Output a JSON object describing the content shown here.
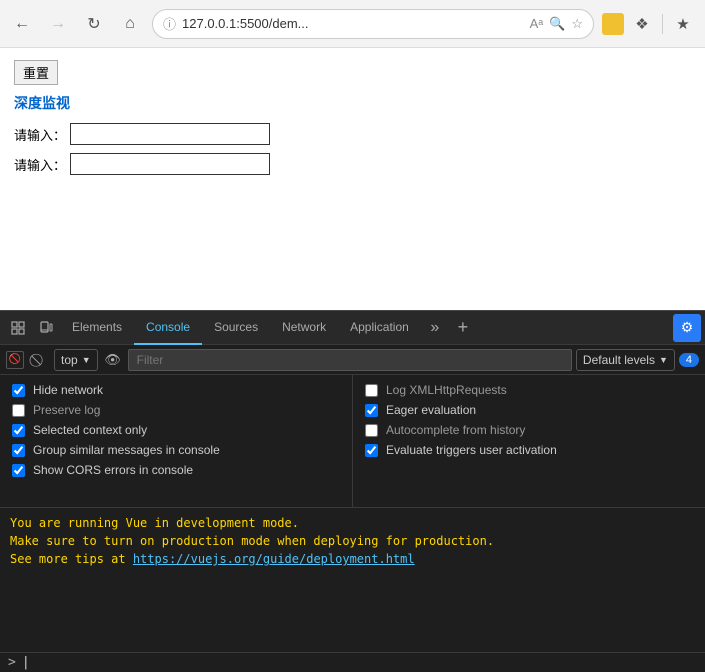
{
  "browser": {
    "address": "127.0.0.1:5500/dem...",
    "nav": {
      "back": "←",
      "forward": "→",
      "refresh": "↻",
      "home": "⌂"
    }
  },
  "page": {
    "reset_label": "重置",
    "title": "深度监视",
    "label1": "请输入：",
    "label2": "请输入：",
    "input1_value": "",
    "input2_value": ""
  },
  "devtools": {
    "tabs": [
      "Elements",
      "Console",
      "Sources",
      "Network",
      "Application"
    ],
    "active_tab": "Console",
    "toolbar": {
      "context": "top",
      "filter_placeholder": "Filter",
      "levels_label": "Default levels",
      "badge_count": "4"
    },
    "settings": {
      "left": [
        {
          "label": "Hide network",
          "checked": true
        },
        {
          "label": "Preserve log",
          "checked": false
        },
        {
          "label": "Selected context only",
          "checked": true
        },
        {
          "label": "Group similar messages in console",
          "checked": true
        },
        {
          "label": "Show CORS errors in console",
          "checked": true
        }
      ],
      "right": [
        {
          "label": "Log XMLHttpRequests",
          "checked": false
        },
        {
          "label": "Eager evaluation",
          "checked": true
        },
        {
          "label": "Autocomplete from history",
          "checked": false
        },
        {
          "label": "Evaluate triggers user activation",
          "checked": true
        }
      ]
    },
    "console_output": {
      "line1": "You are running Vue in development mode.",
      "line2": "Make sure to turn on production mode when deploying for production.",
      "line3_prefix": "See more tips at ",
      "line3_link": "https://vuejs.org/guide/deployment.html"
    },
    "prompt": ">"
  }
}
